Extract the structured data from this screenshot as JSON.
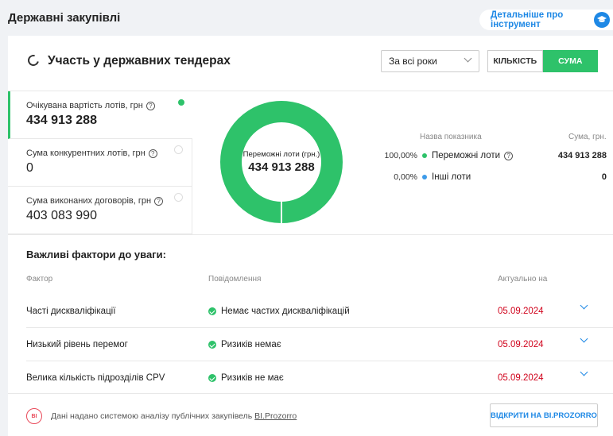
{
  "page": {
    "title": "Державні закупівлі",
    "details_button": "Детальніше про інструмент"
  },
  "header": {
    "title": "Участь у державних тендерах",
    "year_select": "За всі роки",
    "toggle_count": "КІЛЬКІСТЬ",
    "toggle_sum": "СУМА"
  },
  "metrics": [
    {
      "label": "Очікувана вартість лотів, грн",
      "value": "434 913 288",
      "active": true
    },
    {
      "label": "Сума конкурентних лотів, грн",
      "value": "0",
      "active": false
    },
    {
      "label": "Сума виконаних договорів, грн",
      "value": "403 083 990",
      "active": false
    }
  ],
  "donut": {
    "center_label": "Переможні лоти (грн.)",
    "center_value": "434 913 288",
    "segments": [
      {
        "name": "Переможні лоти",
        "percent": 100,
        "color": "#2ec26a"
      },
      {
        "name": "Інші лоти",
        "percent": 0,
        "color": "#3d9be9"
      }
    ]
  },
  "legend": {
    "col_name": "Назва показника",
    "col_sum": "Сума, грн.",
    "rows": [
      {
        "pct": "100,00%",
        "name": "Переможні лоти",
        "amount": "434 913 288",
        "color": "#2ec26a"
      },
      {
        "pct": "0,00%",
        "name": "Інші лоти",
        "amount": "0",
        "color": "#3d9be9"
      }
    ]
  },
  "factors": {
    "title": "Важливі фактори до уваги:",
    "col_factor": "Фактор",
    "col_message": "Повідомлення",
    "col_date": "Актуально на",
    "rows": [
      {
        "factor": "Часті дискваліфікації",
        "message": "Немає частих дискваліфікацій",
        "date": "05.09.2024"
      },
      {
        "factor": "Низький рівень перемог",
        "message": "Ризиків немає",
        "date": "05.09.2024"
      },
      {
        "factor": "Велика кількість підрозділів CPV",
        "message": "Ризиків не має",
        "date": "05.09.2024"
      }
    ]
  },
  "footer": {
    "logo": "BI",
    "text": "Дані надано системою аналізу публічних закупівель",
    "link": "BI.Prozorro",
    "open_button": "ВІДКРИТИ НА BI.PROZORRO"
  },
  "colors": {
    "accent_green": "#2ec26a",
    "accent_blue": "#1e88e5",
    "date_red": "#d0021b"
  }
}
